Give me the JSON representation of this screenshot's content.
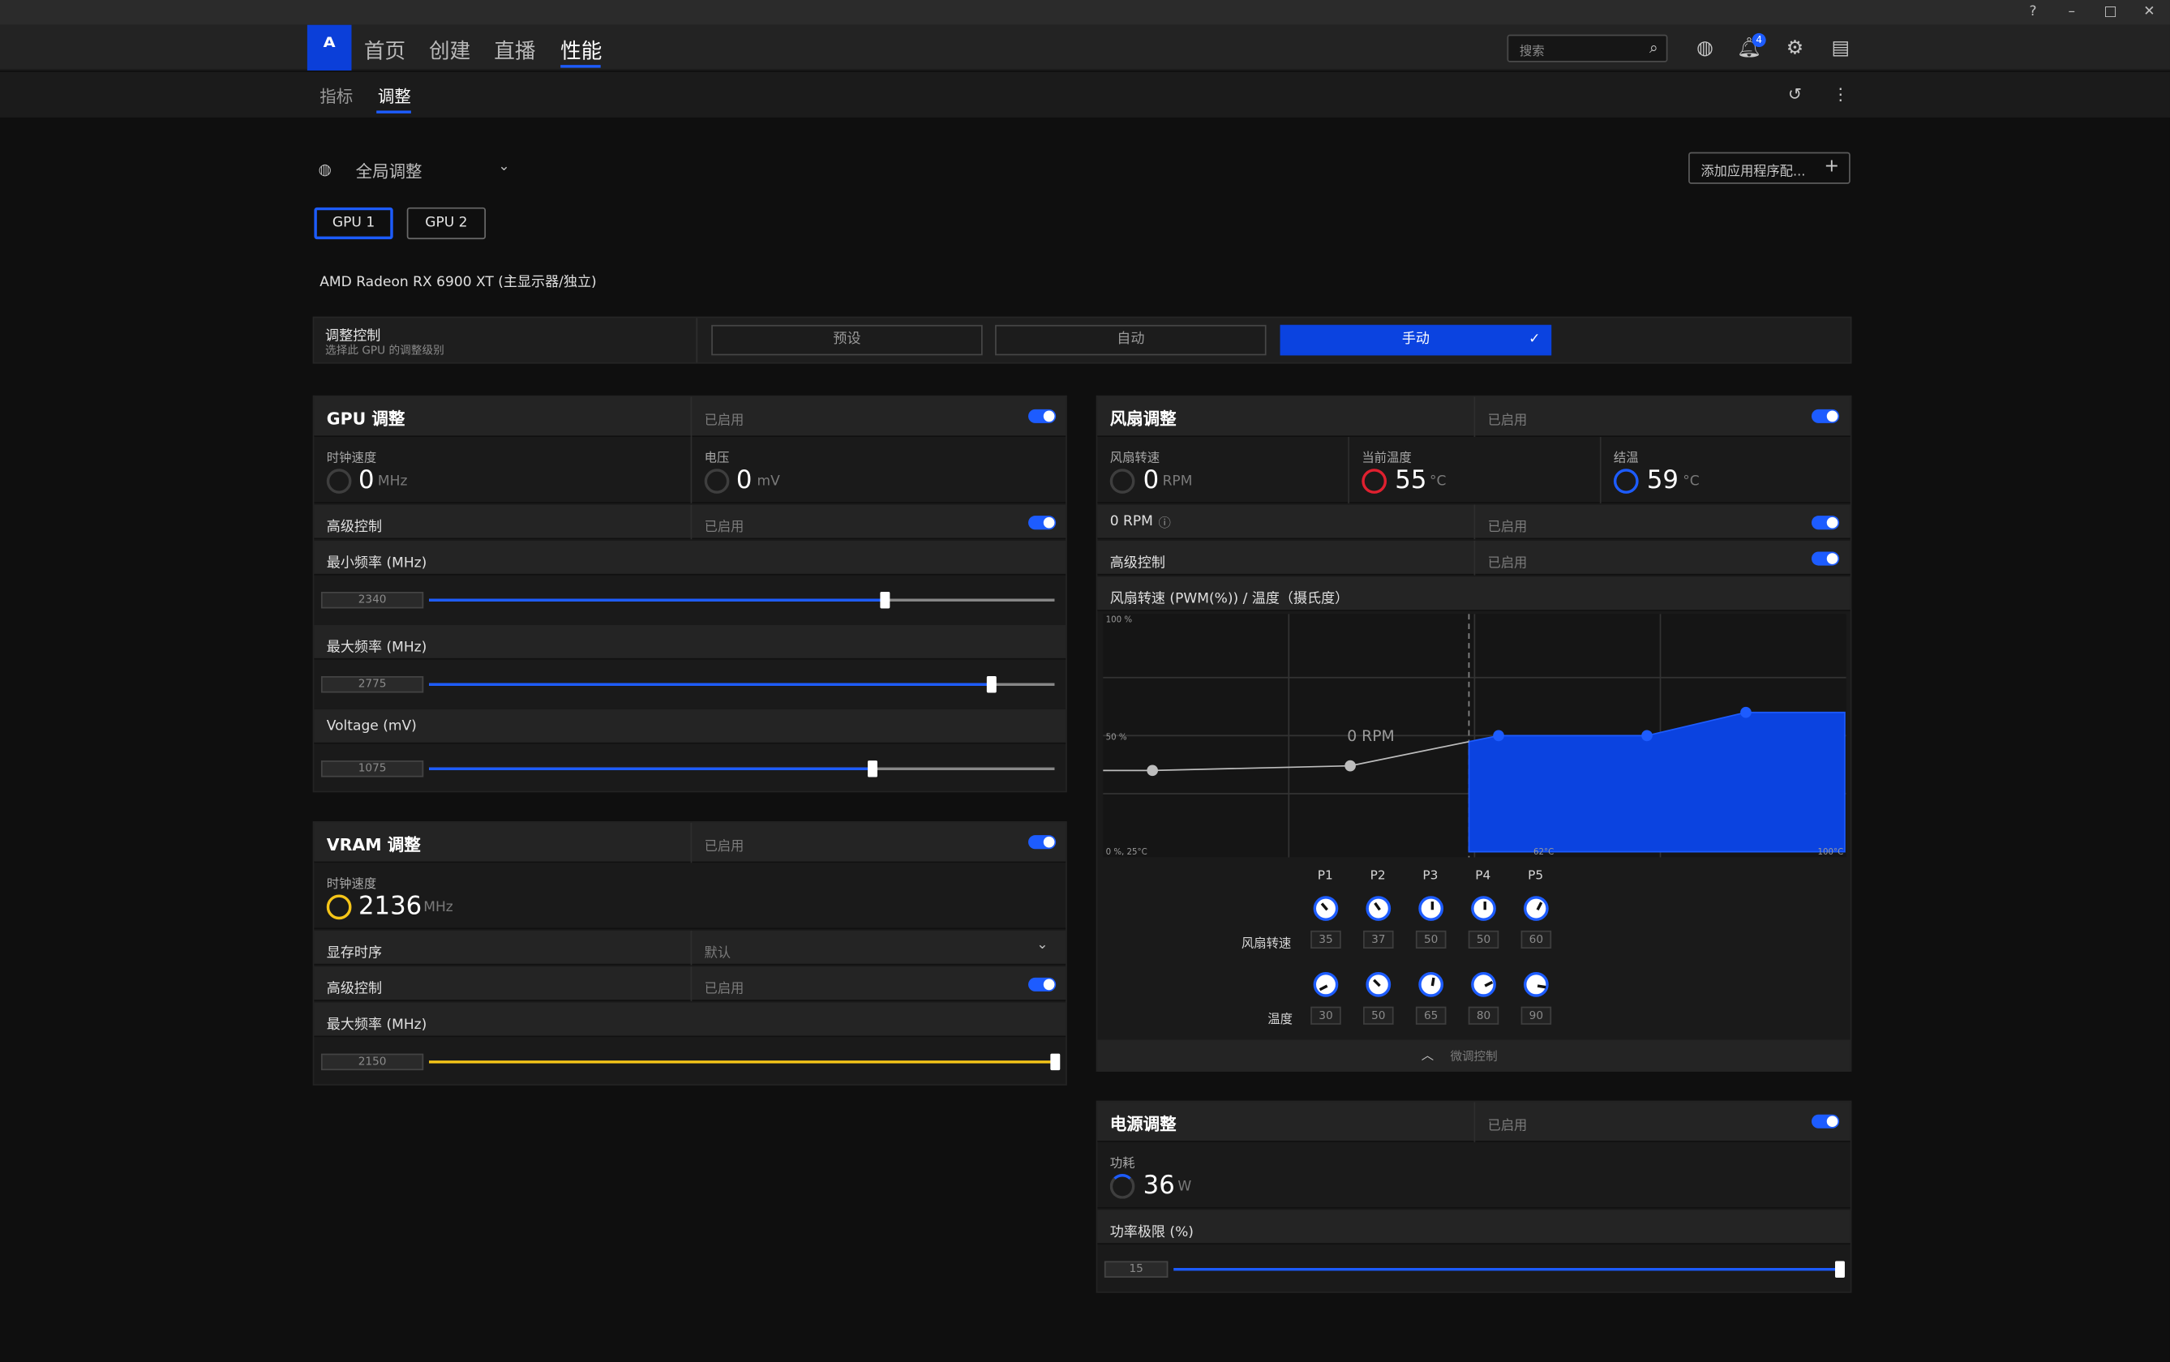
{
  "titlebar": {
    "help": "?",
    "min": "–",
    "max": "□",
    "close": "✕"
  },
  "nav": {
    "logo": "ᴬ",
    "items": [
      "首页",
      "创建",
      "直播",
      "性能"
    ],
    "search_placeholder": "搜索",
    "notif_count": "4"
  },
  "subnav": {
    "items": [
      "指标",
      "调整"
    ]
  },
  "profile": {
    "label": "全局调整",
    "add_app": "添加应用程序配..."
  },
  "gpus": [
    "GPU 1",
    "GPU 2"
  ],
  "gpu_name": "AMD Radeon RX 6900 XT (主显示器/独立)",
  "tuning": {
    "title": "调整控制",
    "subtitle": "选择此 GPU 的调整级别",
    "modes": [
      "预设",
      "自动",
      "手动"
    ]
  },
  "gpu_panel": {
    "title": "GPU 调整",
    "enabled": "已启用",
    "clock_label": "时钟速度",
    "clock_value": "0",
    "clock_unit": "MHz",
    "volt_label": "电压",
    "volt_value": "0",
    "volt_unit": "mV",
    "adv_label": "高级控制",
    "adv_enabled": "已启用",
    "min_freq_label": "最小频率 (MHz)",
    "min_freq": "2340",
    "min_freq_frac": 0.73,
    "max_freq_label": "最大频率 (MHz)",
    "max_freq": "2775",
    "max_freq_frac": 0.9,
    "voltage_label": "Voltage (mV)",
    "voltage": "1075",
    "voltage_frac": 0.71
  },
  "vram_panel": {
    "title": "VRAM 调整",
    "enabled": "已启用",
    "clock_label": "时钟速度",
    "clock_value": "2136",
    "clock_unit": "MHz",
    "timing_label": "显存时序",
    "timing_value": "默认",
    "adv_label": "高级控制",
    "adv_enabled": "已启用",
    "max_freq_label": "最大频率 (MHz)",
    "max_freq": "2150",
    "max_freq_frac": 1.0
  },
  "fan_panel": {
    "title": "风扇调整",
    "enabled": "已启用",
    "speed_label": "风扇转速",
    "speed_value": "0",
    "speed_unit": "RPM",
    "temp_label": "当前温度",
    "temp_value": "55",
    "temp_unit": "°C",
    "junction_label": "结温",
    "junction_value": "59",
    "junction_unit": "°C",
    "zero_rpm_label": "0 RPM",
    "zero_rpm_enabled": "已启用",
    "adv_label": "高级控制",
    "adv_enabled": "已启用",
    "curve_label": "风扇转速 (PWM(%)) / 温度（摄氏度）",
    "fan_speed_row": "风扇转速",
    "temp_row": "温度",
    "fine_tune": "微调控制"
  },
  "chart_data": {
    "type": "area",
    "y_top": "100 %",
    "y_mid": "50 %",
    "origin": "0 %, 25°C",
    "x_mid": "62°C",
    "x_end": "100°C",
    "zero_rpm_annotation": "0 RPM",
    "points": [
      "P1",
      "P2",
      "P3",
      "P4",
      "P5"
    ],
    "fan_speed": [
      35,
      37,
      50,
      50,
      60
    ],
    "temperature": [
      30,
      50,
      65,
      80,
      90
    ],
    "zero_rpm_threshold_c": 62,
    "xlim": [
      25,
      100
    ],
    "ylim": [
      0,
      100
    ]
  },
  "power_panel": {
    "title": "电源调整",
    "enabled": "已启用",
    "power_label": "功耗",
    "power_value": "36",
    "power_unit": "W",
    "limit_label": "功率极限 (%)",
    "limit_value": "15",
    "limit_frac": 1.0
  },
  "colors": {
    "accent": "#1d5cff",
    "vram": "#f5c518",
    "temp_red": "#e0202f"
  }
}
